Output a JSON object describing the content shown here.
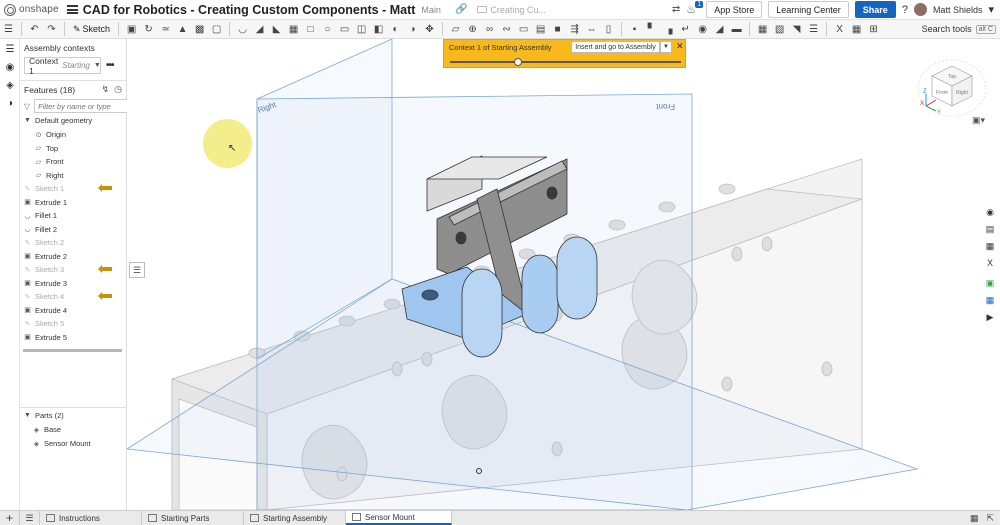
{
  "header": {
    "logo_text": "onshape",
    "doc_title": "CAD for Robotics - Creating Custom Components - Matt",
    "branch": "Main",
    "folder": "Creating Cu...",
    "notifications": "1",
    "app_store": "App Store",
    "learning_center": "Learning Center",
    "share": "Share",
    "help": "?",
    "user": "Matt Shields"
  },
  "toolbar": {
    "sketch_label": "Sketch",
    "search_label": "Search tools",
    "search_shortcut": "alt C"
  },
  "assembly_contexts": {
    "header": "Assembly contexts",
    "context_name": "Context 1",
    "context_state": "Starting"
  },
  "features": {
    "header": "Features (18)",
    "filter_placeholder": "Filter by name or type",
    "default_geometry": "Default geometry",
    "items": [
      {
        "label": "Origin",
        "icon": "origin-icon",
        "suppressed": false
      },
      {
        "label": "Top",
        "icon": "plane-icon",
        "suppressed": false
      },
      {
        "label": "Front",
        "icon": "plane-icon",
        "suppressed": false
      },
      {
        "label": "Right",
        "icon": "plane-icon",
        "suppressed": false
      },
      {
        "label": "Sketch 1",
        "icon": "sketch-icon",
        "suppressed": true
      },
      {
        "label": "Extrude 1",
        "icon": "extrude-icon",
        "suppressed": false
      },
      {
        "label": "Fillet 1",
        "icon": "fillet-icon",
        "suppressed": false
      },
      {
        "label": "Fillet 2",
        "icon": "fillet-icon",
        "suppressed": false
      },
      {
        "label": "Sketch 2",
        "icon": "sketch-icon",
        "suppressed": true
      },
      {
        "label": "Extrude 2",
        "icon": "extrude-icon",
        "suppressed": false
      },
      {
        "label": "Sketch 3",
        "icon": "sketch-icon",
        "suppressed": true
      },
      {
        "label": "Extrude 3",
        "icon": "extrude-icon",
        "suppressed": false
      },
      {
        "label": "Sketch 4",
        "icon": "sketch-icon",
        "suppressed": true
      },
      {
        "label": "Extrude 4",
        "icon": "extrude-icon",
        "suppressed": false
      },
      {
        "label": "Sketch 5",
        "icon": "sketch-icon",
        "suppressed": true
      },
      {
        "label": "Extrude 5",
        "icon": "extrude-icon",
        "suppressed": false
      }
    ]
  },
  "parts": {
    "header": "Parts (2)",
    "items": [
      "Base",
      "Sensor Mount"
    ]
  },
  "banner": {
    "text": "Context 1 of Starting Assembly",
    "button": "Insert and go to Assembly"
  },
  "viewport": {
    "plane_right": "Right",
    "plane_front": "Front",
    "cube_top": "Top",
    "cube_front": "Front",
    "cube_right": "Right",
    "axis_x": "X",
    "axis_y": "Y",
    "axis_z": "Z",
    "accent_color": "#f7b91b",
    "part_blue": "#9fc6ee"
  },
  "tabs": [
    {
      "label": "Instructions",
      "active": false
    },
    {
      "label": "Starting Parts",
      "active": false
    },
    {
      "label": "Starting Assembly",
      "active": false
    },
    {
      "label": "Sensor Mount",
      "active": true
    }
  ]
}
